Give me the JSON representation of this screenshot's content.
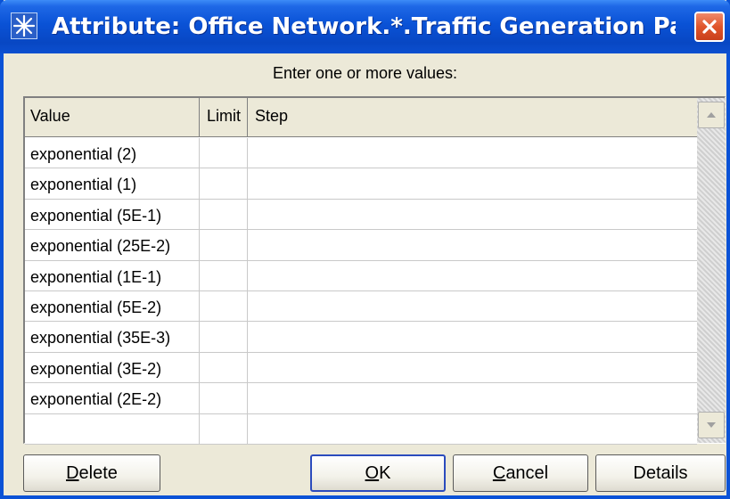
{
  "window": {
    "title": "Attribute: Office Network.*.Traffic Generation Parame…",
    "icon": "star-burst-icon",
    "close_icon": "close-icon"
  },
  "prompt": "Enter one or more values:",
  "table": {
    "columns": [
      "Value",
      "Limit",
      "Step"
    ],
    "rows": [
      {
        "value": "exponential (2)",
        "limit": "",
        "step": ""
      },
      {
        "value": "exponential (1)",
        "limit": "",
        "step": ""
      },
      {
        "value": "exponential (5E-1)",
        "limit": "",
        "step": ""
      },
      {
        "value": "exponential (25E-2)",
        "limit": "",
        "step": ""
      },
      {
        "value": "exponential (1E-1)",
        "limit": "",
        "step": ""
      },
      {
        "value": "exponential (5E-2)",
        "limit": "",
        "step": ""
      },
      {
        "value": "exponential (35E-3)",
        "limit": "",
        "step": ""
      },
      {
        "value": "exponential (3E-2)",
        "limit": "",
        "step": ""
      },
      {
        "value": "exponential (2E-2)",
        "limit": "",
        "step": ""
      },
      {
        "value": "",
        "limit": "",
        "step": ""
      }
    ]
  },
  "buttons": {
    "delete": {
      "first": "D",
      "rest": "elete"
    },
    "ok": {
      "first": "O",
      "rest": "K"
    },
    "cancel": {
      "first": "C",
      "rest": "ancel"
    },
    "details": "Details"
  },
  "colors": {
    "titlebar": "#0a52d6",
    "close_button": "#e0552b",
    "dialog_background": "#ece9d8"
  }
}
